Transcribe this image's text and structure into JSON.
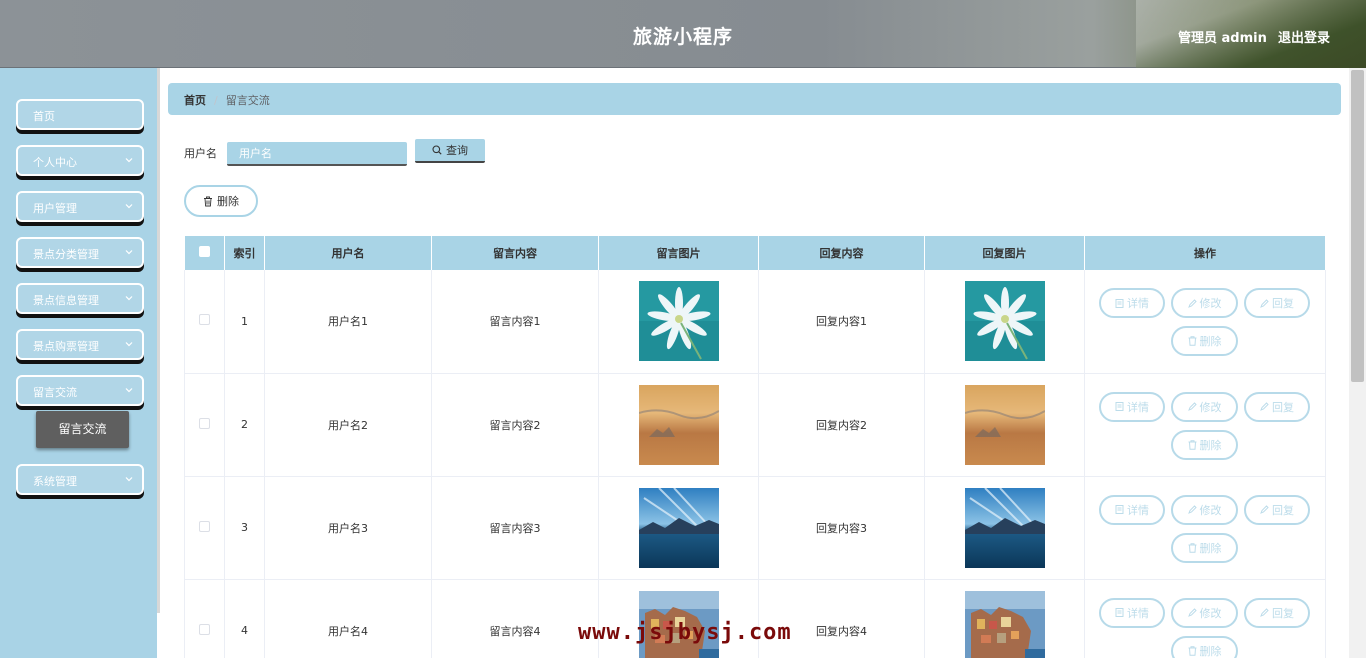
{
  "header": {
    "title": "旅游小程序",
    "admin_label": "管理员 admin",
    "logout": "退出登录"
  },
  "sidebar": {
    "items": [
      {
        "label": "首页",
        "has_chevron": false
      },
      {
        "label": "个人中心",
        "has_chevron": true
      },
      {
        "label": "用户管理",
        "has_chevron": true
      },
      {
        "label": "景点分类管理",
        "has_chevron": true
      },
      {
        "label": "景点信息管理",
        "has_chevron": true
      },
      {
        "label": "景点购票管理",
        "has_chevron": true
      },
      {
        "label": "留言交流",
        "has_chevron": true
      },
      {
        "label": "系统管理",
        "has_chevron": true
      }
    ],
    "active_sub": "留言交流"
  },
  "breadcrumb": {
    "home": "首页",
    "separator": "/",
    "current": "留言交流"
  },
  "search": {
    "label": "用户名",
    "placeholder": "用户名",
    "value": "",
    "query_label": "查询"
  },
  "toolbar": {
    "delete_label": "删除"
  },
  "table": {
    "columns": [
      "索引",
      "用户名",
      "留言内容",
      "留言图片",
      "回复内容",
      "回复图片",
      "操作"
    ],
    "rows": [
      {
        "index": "1",
        "username": "用户名1",
        "content": "留言内容1",
        "image": "flower",
        "reply": "回复内容1",
        "reply_image": "flower"
      },
      {
        "index": "2",
        "username": "用户名2",
        "content": "留言内容2",
        "image": "sunset",
        "reply": "回复内容2",
        "reply_image": "sunset"
      },
      {
        "index": "3",
        "username": "用户名3",
        "content": "留言内容3",
        "image": "lake",
        "reply": "回复内容3",
        "reply_image": "lake"
      },
      {
        "index": "4",
        "username": "用户名4",
        "content": "留言内容4",
        "image": "village",
        "reply": "回复内容4",
        "reply_image": "village"
      }
    ],
    "actions": {
      "detail": "详情",
      "edit": "修改",
      "reply": "回复",
      "delete": "删除"
    }
  },
  "watermark": "www.jsjbysj.com",
  "colors": {
    "accent": "#a9d4e6",
    "header_bg": "#868c91",
    "sub_active": "#5f5f5f",
    "watermark": "#7a0a0a"
  }
}
